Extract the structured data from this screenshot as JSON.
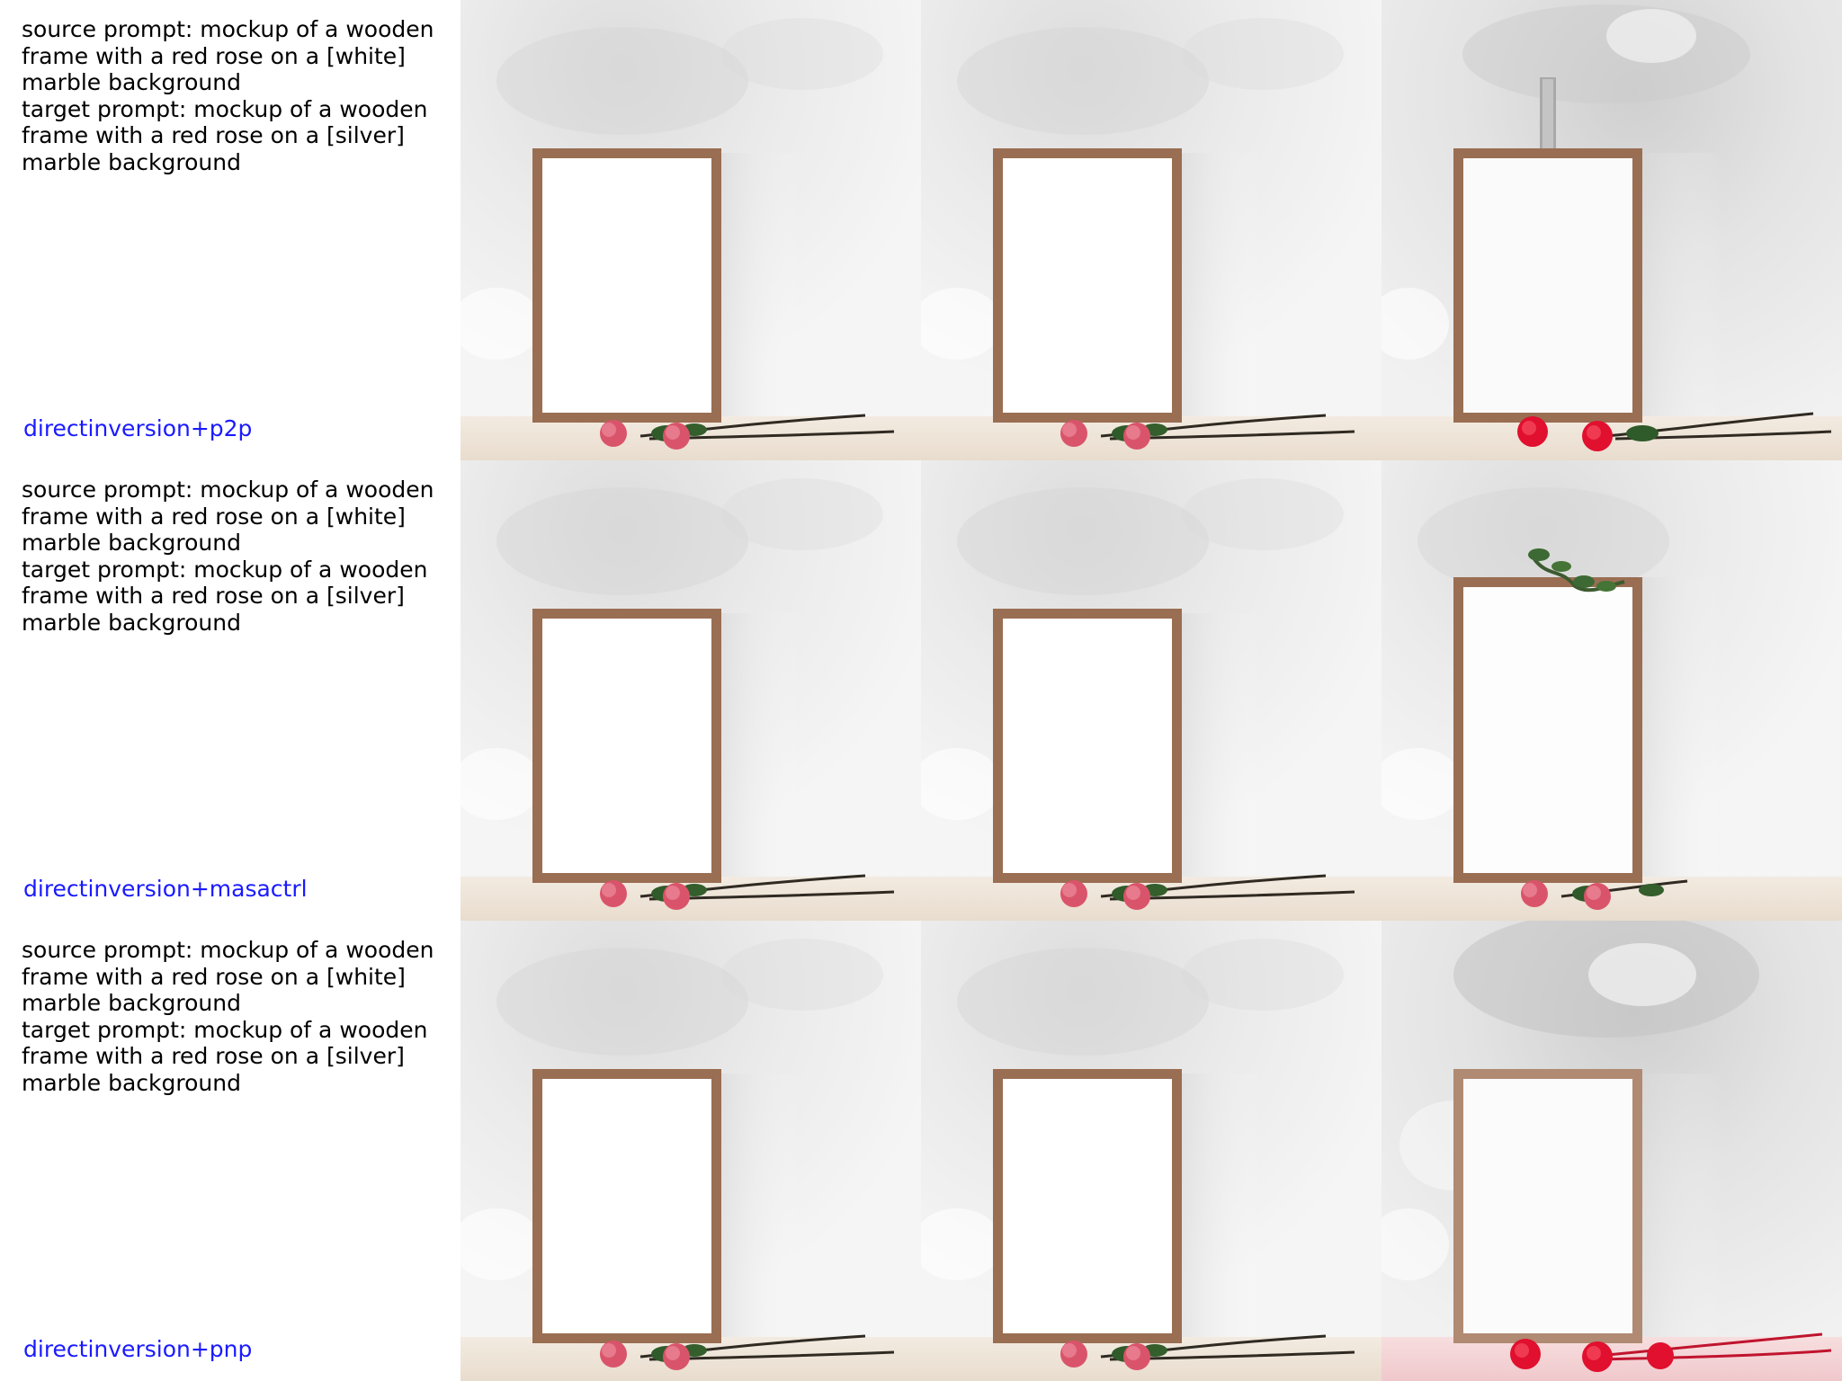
{
  "panel": {
    "source_prompt": "source prompt: mockup of a wooden frame with a red rose on a [white] marble background",
    "target_prompt": "target prompt: mockup of a wooden frame with a red rose on a [silver] marble background",
    "rows": [
      {
        "method": "directinversion+p2p",
        "prompt_lines": "source prompt: mockup of a wooden\nframe with a red rose on a [white]\nmarble background\ntarget prompt: mockup of a wooden\nframe with a red rose on a [silver]\nmarble background"
      },
      {
        "method": "directinversion+masactrl",
        "prompt_lines": "source prompt: mockup of a wooden\nframe with a red rose on a [white]\nmarble background\ntarget prompt: mockup of a wooden\nframe with a red rose on a [silver]\nmarble background"
      },
      {
        "method": "directinversion+pnp",
        "prompt_lines": "source prompt: mockup of a wooden\nframe with a red rose on a [white]\nmarble background\ntarget prompt: mockup of a wooden\nframe with a red rose on a [silver]\nmarble background"
      }
    ],
    "colors": {
      "method_label": "#1a1aff",
      "prompt_text": "#000000",
      "frame_wood": "#9a6e52",
      "rose_pink": "#d9546a",
      "rose_red": "#e0102e",
      "shelf": "#efe3d6"
    }
  }
}
